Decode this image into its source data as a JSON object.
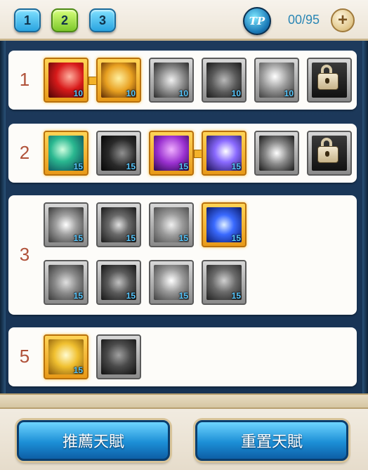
{
  "tabs": [
    {
      "label": "1"
    },
    {
      "label": "2"
    },
    {
      "label": "3"
    }
  ],
  "tp": {
    "badge": "TP",
    "points": "00/95",
    "plus": "+"
  },
  "rows": [
    {
      "tier": "1",
      "slots": [
        {
          "level": "10",
          "state": "active",
          "art": "red-slash-icon"
        },
        {
          "level": "10",
          "state": "active",
          "art": "golden-torso-icon"
        },
        {
          "level": "10",
          "state": "inactive",
          "art": "warrior-grey-icon"
        },
        {
          "level": "10",
          "state": "inactive",
          "art": "muscle-grey-icon"
        },
        {
          "level": "10",
          "state": "inactive",
          "art": "leap-grey-icon"
        },
        {
          "level": "",
          "state": "locked",
          "art": "lock-icon"
        }
      ]
    },
    {
      "tier": "2",
      "slots": [
        {
          "level": "15",
          "state": "active",
          "art": "spear-burst-icon"
        },
        {
          "level": "15",
          "state": "inactive",
          "art": "dark-eye-icon"
        },
        {
          "level": "15",
          "state": "active",
          "art": "purple-mage-icon"
        },
        {
          "level": "15",
          "state": "active",
          "art": "violet-blast-icon"
        },
        {
          "level": "",
          "state": "inactive",
          "art": "white-strike-icon"
        },
        {
          "level": "",
          "state": "locked",
          "art": "lock-icon"
        }
      ]
    },
    {
      "tier": "3",
      "slots": [
        {
          "level": "15",
          "state": "inactive",
          "art": "burst-grey-icon"
        },
        {
          "level": "15",
          "state": "inactive",
          "art": "burst-dark-icon"
        },
        {
          "level": "15",
          "state": "inactive",
          "art": "swirl-grey-icon"
        },
        {
          "level": "15",
          "state": "active",
          "art": "blue-vortex-icon"
        },
        {
          "level": "15",
          "state": "inactive",
          "art": "wisp-grey-icon"
        },
        {
          "level": "15",
          "state": "inactive",
          "art": "claw-dark-icon"
        },
        {
          "level": "15",
          "state": "inactive",
          "art": "beast-grey-icon"
        },
        {
          "level": "15",
          "state": "inactive",
          "art": "wolf-dark-icon"
        }
      ]
    },
    {
      "tier": "5",
      "slots": [
        {
          "level": "15",
          "state": "active",
          "art": "golden-hero-icon"
        },
        {
          "level": "",
          "state": "inactive",
          "art": "shadow-figure-icon"
        }
      ]
    }
  ],
  "buttons": {
    "recommend": "推薦天賦",
    "reset": "重置天賦"
  },
  "colors": {
    "active_border": "#e89a18",
    "level_text": "#58c8ff",
    "tier_text": "#b0523a",
    "button_blue": "#1c8fd6"
  }
}
